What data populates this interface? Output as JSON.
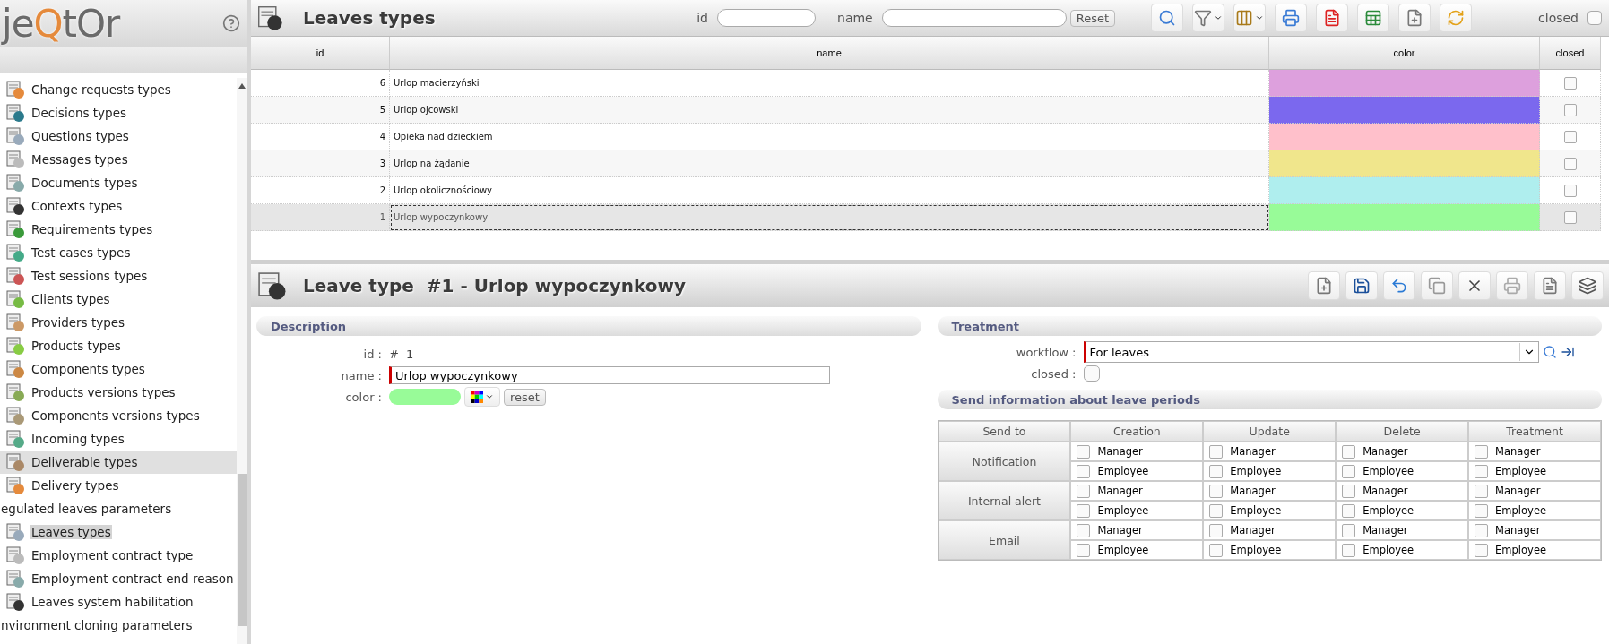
{
  "sidebar": {
    "logo": [
      {
        "text": "je",
        "color": "#6a6a6a"
      },
      {
        "text": "Q",
        "color": "#e58a3c"
      },
      {
        "text": "tOr",
        "color": "#6a6a6a"
      }
    ],
    "items": [
      {
        "label": "Change requests types",
        "kind": "item",
        "selected": false,
        "hovered": false
      },
      {
        "label": "Decisions types",
        "kind": "item",
        "selected": false,
        "hovered": false
      },
      {
        "label": "Questions types",
        "kind": "item",
        "selected": false,
        "hovered": false
      },
      {
        "label": "Messages types",
        "kind": "item",
        "selected": false,
        "hovered": false
      },
      {
        "label": "Documents types",
        "kind": "item",
        "selected": false,
        "hovered": false
      },
      {
        "label": "Contexts types",
        "kind": "item",
        "selected": false,
        "hovered": false
      },
      {
        "label": "Requirements types",
        "kind": "item",
        "selected": false,
        "hovered": false
      },
      {
        "label": "Test cases types",
        "kind": "item",
        "selected": false,
        "hovered": false
      },
      {
        "label": "Test sessions types",
        "kind": "item",
        "selected": false,
        "hovered": false
      },
      {
        "label": "Clients types",
        "kind": "item",
        "selected": false,
        "hovered": false
      },
      {
        "label": "Providers types",
        "kind": "item",
        "selected": false,
        "hovered": false
      },
      {
        "label": "Products types",
        "kind": "item",
        "selected": false,
        "hovered": false
      },
      {
        "label": "Components types",
        "kind": "item",
        "selected": false,
        "hovered": false
      },
      {
        "label": "Products versions types",
        "kind": "item",
        "selected": false,
        "hovered": false
      },
      {
        "label": "Components versions types",
        "kind": "item",
        "selected": false,
        "hovered": false
      },
      {
        "label": "Incoming types",
        "kind": "item",
        "selected": false,
        "hovered": false
      },
      {
        "label": "Deliverable types",
        "kind": "item",
        "selected": false,
        "hovered": true
      },
      {
        "label": "Delivery types",
        "kind": "item",
        "selected": false,
        "hovered": false
      },
      {
        "label": "egulated leaves parameters",
        "kind": "group",
        "selected": false,
        "hovered": false
      },
      {
        "label": "Leaves types",
        "kind": "item",
        "selected": true,
        "hovered": false
      },
      {
        "label": "Employment contract type",
        "kind": "item",
        "selected": false,
        "hovered": false
      },
      {
        "label": "Employment contract end reason",
        "kind": "item",
        "selected": false,
        "hovered": false
      },
      {
        "label": "Leaves system habilitation",
        "kind": "item",
        "selected": false,
        "hovered": false
      },
      {
        "label": "nvironment cloning parameters",
        "kind": "group",
        "selected": false,
        "hovered": false
      }
    ]
  },
  "list_header": {
    "title": "Leaves types",
    "filters": [
      {
        "label": "id"
      },
      {
        "label": "name"
      }
    ],
    "reset": "Reset",
    "closed_label": "closed",
    "closed_checked": false
  },
  "table": {
    "columns": [
      "id",
      "name",
      "color",
      "closed"
    ],
    "rows": [
      {
        "id": "6",
        "name": "Urlop macierzyński",
        "color": "#dda0dd",
        "closed": false,
        "selected": false
      },
      {
        "id": "5",
        "name": "Urlop ojcowski",
        "color": "#7b68ee",
        "closed": false,
        "selected": false
      },
      {
        "id": "4",
        "name": "Opieka nad dzieckiem",
        "color": "#ffc0cb",
        "closed": false,
        "selected": false
      },
      {
        "id": "3",
        "name": "Urlop na żądanie",
        "color": "#f0e68c",
        "closed": false,
        "selected": false
      },
      {
        "id": "2",
        "name": "Urlop okolicznościowy",
        "color": "#afeeee",
        "closed": false,
        "selected": false
      },
      {
        "id": "1",
        "name": "Urlop wypoczynkowy",
        "color": "#98fb98",
        "closed": false,
        "selected": true
      }
    ]
  },
  "detail": {
    "title": "Leave type  #1 - Urlop wypoczynkowy",
    "description": {
      "title": "Description",
      "id_label": "id :",
      "id_value": "# 1",
      "name_label": "name :",
      "name_value": "Urlop wypoczynkowy",
      "color_label": "color :",
      "color": "#98fb98",
      "reset": "reset"
    },
    "treatment": {
      "title": "Treatment",
      "workflow_label": "workflow :",
      "workflow_value": "For leaves",
      "closed_label": "closed :",
      "closed": false
    },
    "send_info": {
      "title": "Send information about leave periods",
      "columns": [
        "Send to",
        "Creation",
        "Update",
        "Delete",
        "Treatment"
      ],
      "rows": [
        {
          "label": "Notification",
          "options": [
            [
              {
                "label": "Manager",
                "checked": false
              },
              {
                "label": "Employee",
                "checked": false
              }
            ],
            [
              {
                "label": "Manager",
                "checked": false
              },
              {
                "label": "Employee",
                "checked": false
              }
            ],
            [
              {
                "label": "Manager",
                "checked": false
              },
              {
                "label": "Employee",
                "checked": false
              }
            ],
            [
              {
                "label": "Manager",
                "checked": false
              },
              {
                "label": "Employee",
                "checked": false
              }
            ]
          ]
        },
        {
          "label": "Internal alert",
          "options": [
            [
              {
                "label": "Manager",
                "checked": false
              },
              {
                "label": "Employee",
                "checked": false
              }
            ],
            [
              {
                "label": "Manager",
                "checked": false
              },
              {
                "label": "Employee",
                "checked": false
              }
            ],
            [
              {
                "label": "Manager",
                "checked": false
              },
              {
                "label": "Employee",
                "checked": false
              }
            ],
            [
              {
                "label": "Manager",
                "checked": false
              },
              {
                "label": "Employee",
                "checked": false
              }
            ]
          ]
        },
        {
          "label": "Email",
          "options": [
            [
              {
                "label": "Manager",
                "checked": false
              },
              {
                "label": "Employee",
                "checked": false
              }
            ],
            [
              {
                "label": "Manager",
                "checked": false
              },
              {
                "label": "Employee",
                "checked": false
              }
            ],
            [
              {
                "label": "Manager",
                "checked": false
              },
              {
                "label": "Employee",
                "checked": false
              }
            ],
            [
              {
                "label": "Manager",
                "checked": false
              },
              {
                "label": "Employee",
                "checked": false
              }
            ]
          ]
        }
      ]
    }
  }
}
